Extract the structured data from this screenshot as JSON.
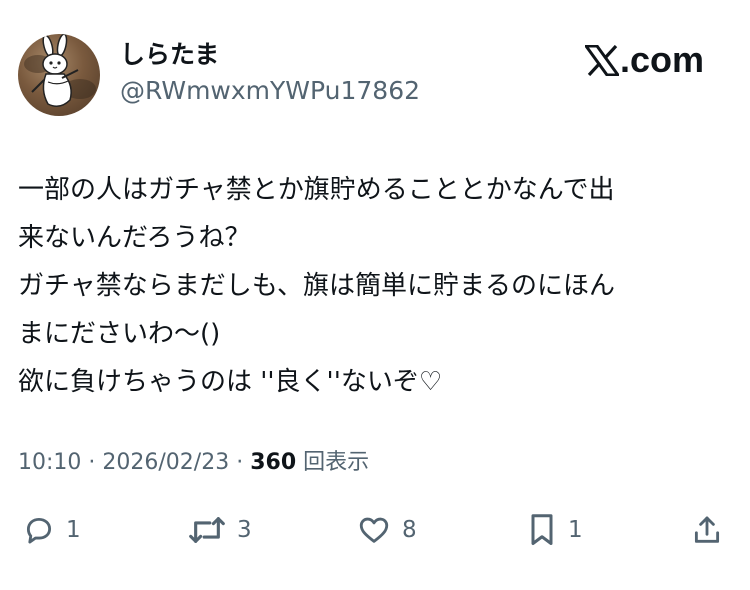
{
  "user": {
    "display_name": "しらたま",
    "handle": "@RWmwxmYWPu17862",
    "avatar_icon": "cartoon-rabbit-avatar"
  },
  "brand": {
    "icon": "x-logo-icon",
    "text": ".com"
  },
  "tweet": {
    "lines": [
      "一部の人はガチャ禁とか旗貯めることとかなんで出",
      "来ないんだろうね？",
      "ガチャ禁ならまだしも、旗は簡単に貯まるのにほん",
      "まにださいわ〜()",
      "欲に負けちゃうのは ''良く''ないぞ♡"
    ],
    "time": "10:10",
    "date": "2026/02/23",
    "separator": "·",
    "views": "360",
    "views_label": "回表示"
  },
  "actions": {
    "reply": {
      "icon": "reply-icon",
      "count": "1"
    },
    "retweet": {
      "icon": "retweet-icon",
      "count": "3"
    },
    "like": {
      "icon": "heart-icon",
      "count": "8"
    },
    "bookmark": {
      "icon": "bookmark-icon",
      "count": "1"
    },
    "share": {
      "icon": "share-icon"
    }
  },
  "colors": {
    "text": "#0f1419",
    "secondary": "#536471",
    "background": "#ffffff"
  }
}
